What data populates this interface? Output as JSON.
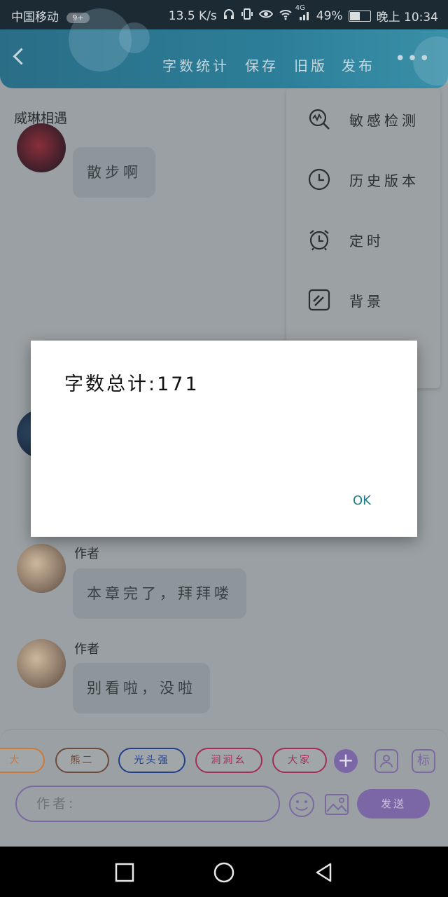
{
  "status": {
    "carrier": "中国移动",
    "badge": "9+",
    "speed": "13.5 K/s",
    "network": "4G",
    "battery": "49%",
    "time": "晚上 10:34",
    "battery_level": 0.49
  },
  "toolbar": {
    "word_count_label": "字数统计",
    "save_label": "保存",
    "old_version_label": "旧版",
    "publish_label": "发布"
  },
  "chat": {
    "title": "威琳相遇",
    "messages": [
      {
        "author": "",
        "text": "散步啊"
      },
      {
        "author": "作者",
        "text": "本章完了，拜拜喽"
      },
      {
        "author": "作者",
        "text": "别看啦，没啦"
      }
    ]
  },
  "menu": {
    "items": [
      {
        "label": "敏感检测",
        "icon": "sensitive-check-icon"
      },
      {
        "label": "历史版本",
        "icon": "clock-icon"
      },
      {
        "label": "定时",
        "icon": "alarm-clock-icon"
      },
      {
        "label": "背景",
        "icon": "background-icon"
      }
    ]
  },
  "composer": {
    "chips": [
      "大",
      "熊二",
      "光头强",
      "涧涧幺",
      "大家"
    ],
    "chip_colors": [
      "#c8793e",
      "#6b4b3c",
      "#243f8a",
      "#a12e56",
      "#a12e56"
    ],
    "add_label": "+",
    "tag_label": "标",
    "input_placeholder": "作者:",
    "send_label": "发送"
  },
  "dialog": {
    "message": "字数总计:171",
    "ok_label": "OK"
  },
  "colors": {
    "accent": "#2c7e98",
    "purple": "#7b67a5",
    "ok_text": "#1f7d8a"
  }
}
